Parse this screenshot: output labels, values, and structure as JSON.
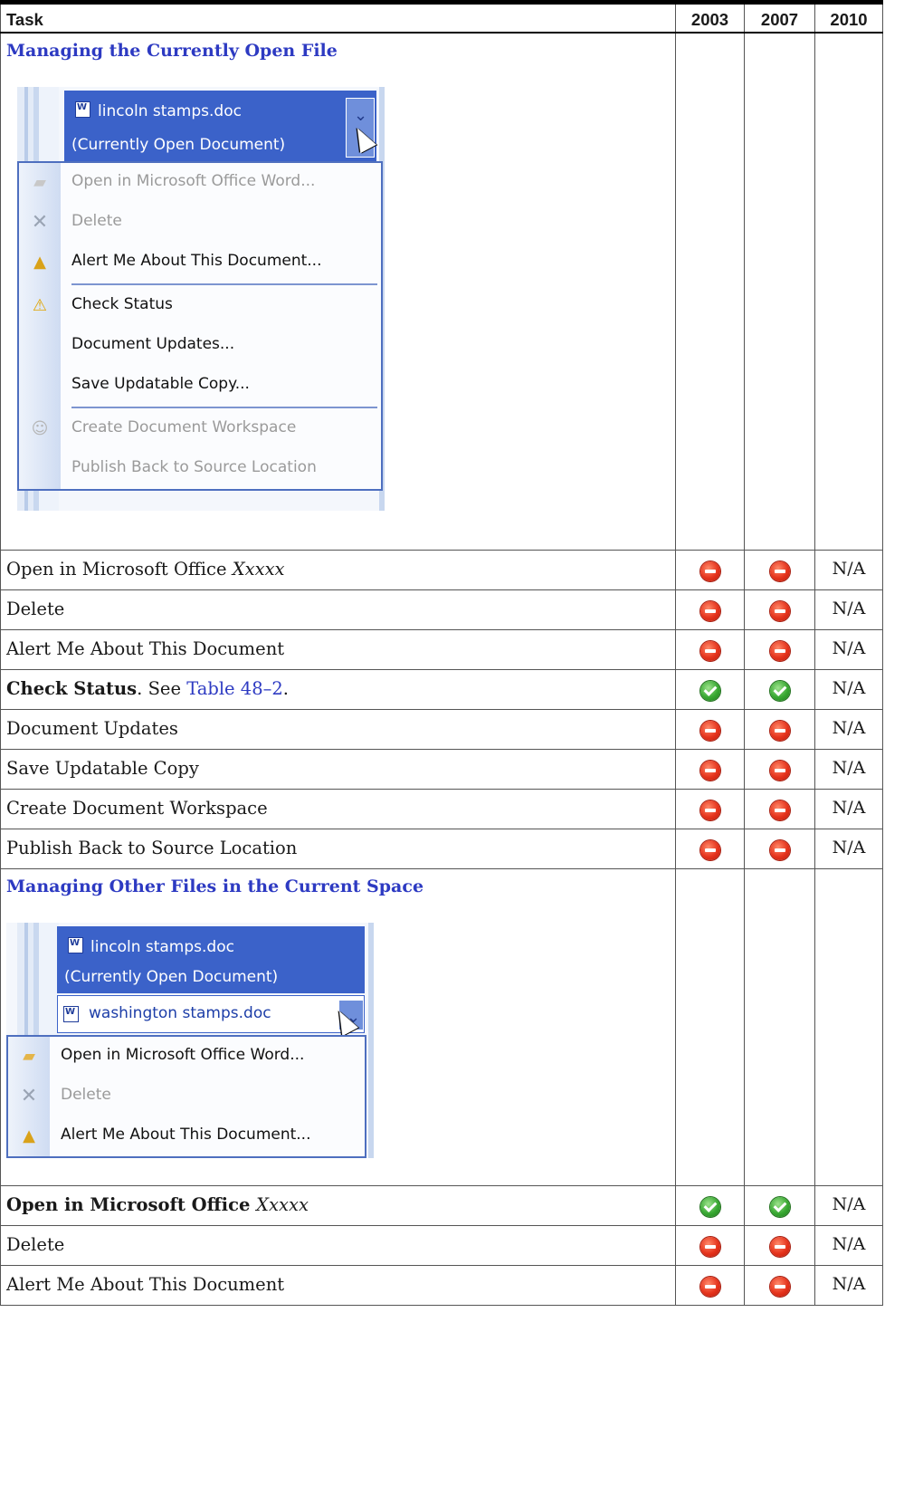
{
  "table": {
    "headers": {
      "task": "Task",
      "v2003": "2003",
      "v2007": "2007",
      "v2010": "2010"
    }
  },
  "section1": {
    "title": "Managing the Currently Open File",
    "screenshot": {
      "doc_name": "lincoln stamps.doc",
      "doc_status": "(Currently Open Document)",
      "menu_items": [
        {
          "label": "Open in Microsoft Office Word...",
          "icon": "folder-icon",
          "enabled": false
        },
        {
          "label": "Delete",
          "icon": "x-icon",
          "enabled": false
        },
        {
          "label": "Alert Me About This Document...",
          "icon": "bell-icon",
          "enabled": true
        },
        {
          "label": "Check Status",
          "icon": "warning-icon",
          "enabled": true
        },
        {
          "label": "Document Updates...",
          "icon": "",
          "enabled": true
        },
        {
          "label": "Save Updatable Copy...",
          "icon": "",
          "enabled": true
        },
        {
          "label": "Create Document Workspace",
          "icon": "people-icon",
          "enabled": false
        },
        {
          "label": "Publish Back to Source Location",
          "icon": "",
          "enabled": false
        }
      ]
    },
    "rows": [
      {
        "task": "Open in Microsoft Office ",
        "task_italic": "Xxxxx",
        "v2003": "no",
        "v2007": "no",
        "v2010": "N/A"
      },
      {
        "task": "Delete",
        "v2003": "no",
        "v2007": "no",
        "v2010": "N/A"
      },
      {
        "task": "Alert Me About This Document",
        "v2003": "no",
        "v2007": "no",
        "v2010": "N/A"
      },
      {
        "task": "Check Status",
        "task_suffix": ". See ",
        "task_link": "Table 48–2",
        "task_end": ".",
        "v2003": "yes",
        "v2007": "yes",
        "v2010": "N/A"
      },
      {
        "task": "Document Updates",
        "v2003": "no",
        "v2007": "no",
        "v2010": "N/A"
      },
      {
        "task": "Save Updatable Copy",
        "v2003": "no",
        "v2007": "no",
        "v2010": "N/A"
      },
      {
        "task": "Create Document Workspace",
        "v2003": "no",
        "v2007": "no",
        "v2010": "N/A"
      },
      {
        "task": "Publish Back to Source Location",
        "v2003": "no",
        "v2007": "no",
        "v2010": "N/A"
      }
    ]
  },
  "section2": {
    "title": "Managing Other Files in the Current Space",
    "screenshot": {
      "doc_name": "lincoln stamps.doc",
      "doc_status": "(Currently Open Document)",
      "other_file": "washington stamps.doc",
      "menu_items": [
        {
          "label": "Open in Microsoft Office Word...",
          "icon": "folder-icon",
          "enabled": true
        },
        {
          "label": "Delete",
          "icon": "x-icon",
          "enabled": false
        },
        {
          "label": "Alert Me About This Document...",
          "icon": "bell-icon",
          "enabled": true
        }
      ]
    },
    "rows": [
      {
        "task": "Open in Microsoft Office ",
        "task_italic": "Xxxxx",
        "v2003": "yes",
        "v2007": "yes",
        "v2010": "N/A"
      },
      {
        "task": "Delete",
        "v2003": "no",
        "v2007": "no",
        "v2010": "N/A"
      },
      {
        "task": "Alert Me About This Document",
        "v2003": "no",
        "v2007": "no",
        "v2010": "N/A"
      }
    ]
  },
  "colors": {
    "link": "#2d3ac2",
    "selection": "#3b62c9",
    "supported": "#38a832",
    "unsupported": "#e5331c"
  }
}
